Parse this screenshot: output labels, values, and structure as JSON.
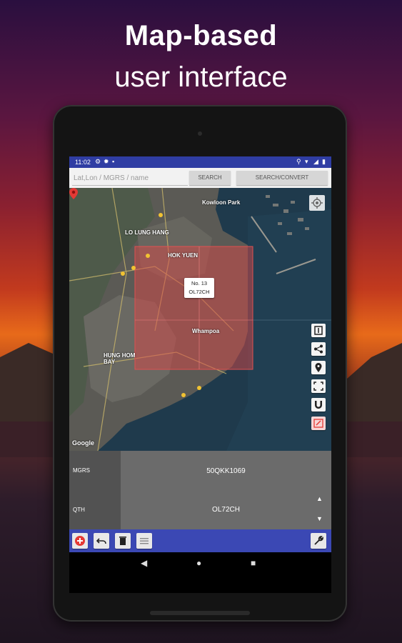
{
  "headline": {
    "line1": "Map-based",
    "line2": "user interface"
  },
  "status": {
    "time": "11:02"
  },
  "search": {
    "placeholder": "Lat,Lon / MGRS / name",
    "search_label": "SEARCH",
    "convert_label": "SEARCH/CONVERT"
  },
  "map": {
    "labels": [
      "HOK YUEN",
      "LO LUNG HANG",
      "HUNG HOM BAY",
      "Whampoa",
      "Kowloon Park"
    ],
    "popup": {
      "line1": "No. 13",
      "line2": "OL72CH"
    },
    "attribution": "Google",
    "zone_color": "#e04a4a"
  },
  "info": {
    "rows": [
      {
        "label": "MGRS",
        "value": "50QKK1069"
      },
      {
        "label": "QTH",
        "value": "OL72CH"
      }
    ]
  },
  "icons": {
    "map_tools": [
      "pause-icon",
      "share-icon",
      "place-icon",
      "fullscreen-icon",
      "magnet-icon",
      "edit-icon"
    ],
    "bottom_tools": [
      "add-icon",
      "undo-icon",
      "delete-icon",
      "list-icon",
      "wrench-icon"
    ]
  },
  "colors": {
    "accent": "#3b48b4",
    "status": "#2f3da3",
    "add_red": "#e53935"
  }
}
